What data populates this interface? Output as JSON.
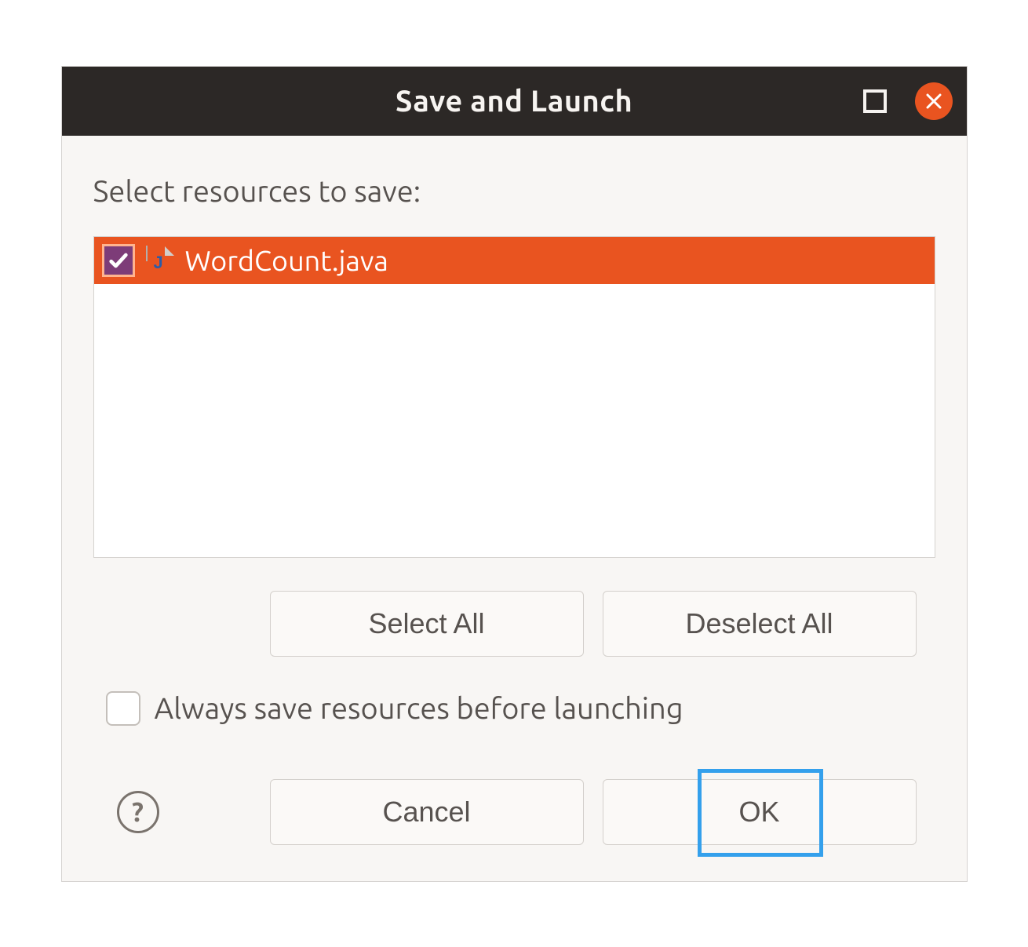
{
  "title": "Save and Launch",
  "prompt": "Select resources to save:",
  "resources": [
    {
      "name": "WordCount.java",
      "checked": true,
      "icon": "java-file-icon"
    }
  ],
  "buttons": {
    "select_all": "Select All",
    "deselect_all": "Deselect All",
    "cancel": "Cancel",
    "ok": "OK"
  },
  "always_save": {
    "label": "Always save resources before launching",
    "checked": false
  },
  "colors": {
    "accent": "#e95420",
    "titlebar": "#2c2826",
    "highlight": "#34a0ec"
  }
}
